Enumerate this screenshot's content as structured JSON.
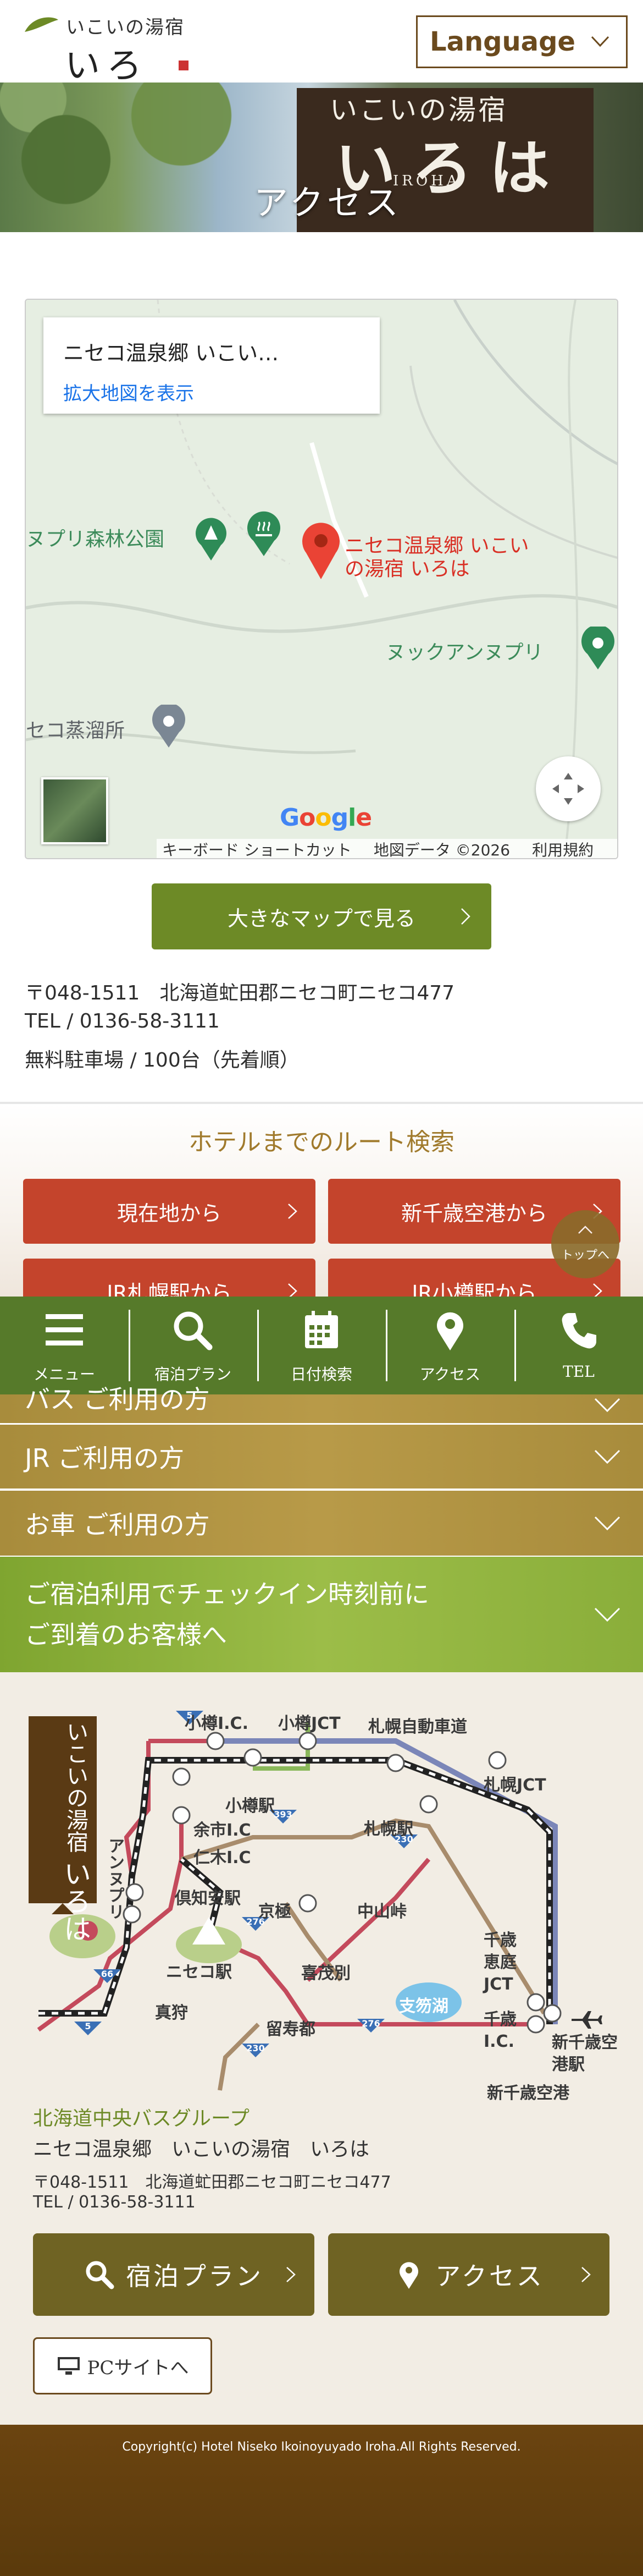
{
  "header": {
    "logo_sub": "いこいの湯宿",
    "logo_main": "いろは",
    "language_label": "Language"
  },
  "hero": {
    "sign_sub": "いこいの湯宿",
    "sign_main": "いろは",
    "sign_roman": "IROHA",
    "page_title": "アクセス"
  },
  "map": {
    "card_name": "ニセコ温泉郷 いこい…",
    "card_link": "拡大地図を表示",
    "labels": {
      "park": "ヌプリ森林公園",
      "hotel_line1": "ニセコ温泉郷 いこい",
      "hotel_line2": "の湯宿 いろは",
      "nupuri": "ヌックアンヌプリ",
      "jotetsu": "セコ蒸溜所"
    },
    "google": "Google",
    "footer": [
      "キーボード ショートカット",
      "地図データ ©2026",
      "利用規約"
    ]
  },
  "big_map_button": "大きなマップで見る",
  "address": {
    "postal": "〒048-1511　北海道虻田郡ニセコ町ニセコ477",
    "tel": "TEL / 0136-58-3111",
    "parking": "無料駐車場 / 100台（先着順）"
  },
  "route_search": {
    "title": "ホテルまでのルート検索",
    "buttons": [
      "現在地から",
      "新千歳空港から",
      "JR札幌駅から",
      "JR小樽駅から"
    ]
  },
  "to_top": "トップへ",
  "nav": [
    {
      "icon": "menu-icon",
      "label": "メニュー"
    },
    {
      "icon": "search-icon",
      "label": "宿泊プラン"
    },
    {
      "icon": "calendar-icon",
      "label": "日付検索"
    },
    {
      "icon": "map-pin-icon",
      "label": "アクセス"
    },
    {
      "icon": "phone-icon",
      "label": "TEL"
    }
  ],
  "accordion": {
    "bus": "バス ご利用の方",
    "jr": "JR ご利用の方",
    "car": "お車 ご利用の方",
    "early_line1": "ご宿泊利用でチェックイン時刻前に",
    "early_line2": "ご到着のお客様へ"
  },
  "route_map": {
    "badge_line1": "いこいの湯宿",
    "badge_line2": "いろは",
    "stations": [
      "小樽I.C.",
      "小樽JCT",
      "札幌自動車道",
      "札幌JCT",
      "小樽駅",
      "余市I.C",
      "仁木I.C",
      "札幌駅",
      "倶知安駅",
      "京極",
      "中山峠",
      "アンヌプリ",
      "ニセコ駅",
      "喜茂別",
      "支笏湖",
      "真狩",
      "留寿都",
      "千歳恵庭JCT",
      "千歳I.C.",
      "新千歳空港駅",
      "新千歳空港"
    ],
    "routes": [
      "5",
      "393",
      "276",
      "230",
      "66",
      "5",
      "230",
      "276"
    ]
  },
  "company": {
    "group": "北海道中央バスグループ",
    "name": "ニセコ温泉郷　いこいの湯宿　いろは",
    "address": "〒048-1511　北海道虻田郡ニセコ町ニセコ477",
    "tel": "TEL / 0136-58-3111"
  },
  "cta": {
    "plan": "宿泊プラン",
    "access": "アクセス",
    "pc": "PCサイトへ"
  },
  "footer": {
    "copyright": "Copyright(c) Hotel Niseko Ikoinoyuyado Iroha.All Rights Reserved."
  },
  "colors": {
    "brand_brown": "#6b4a1e",
    "button_green": "#6d8a26",
    "route_red": "#c4442c",
    "nav_green": "#567a2a",
    "accordion_gold": "#a88c3c",
    "accordion_green": "#8aae3a",
    "cta_olive": "#6f6323",
    "footer_brown": "#5a3a0c"
  }
}
